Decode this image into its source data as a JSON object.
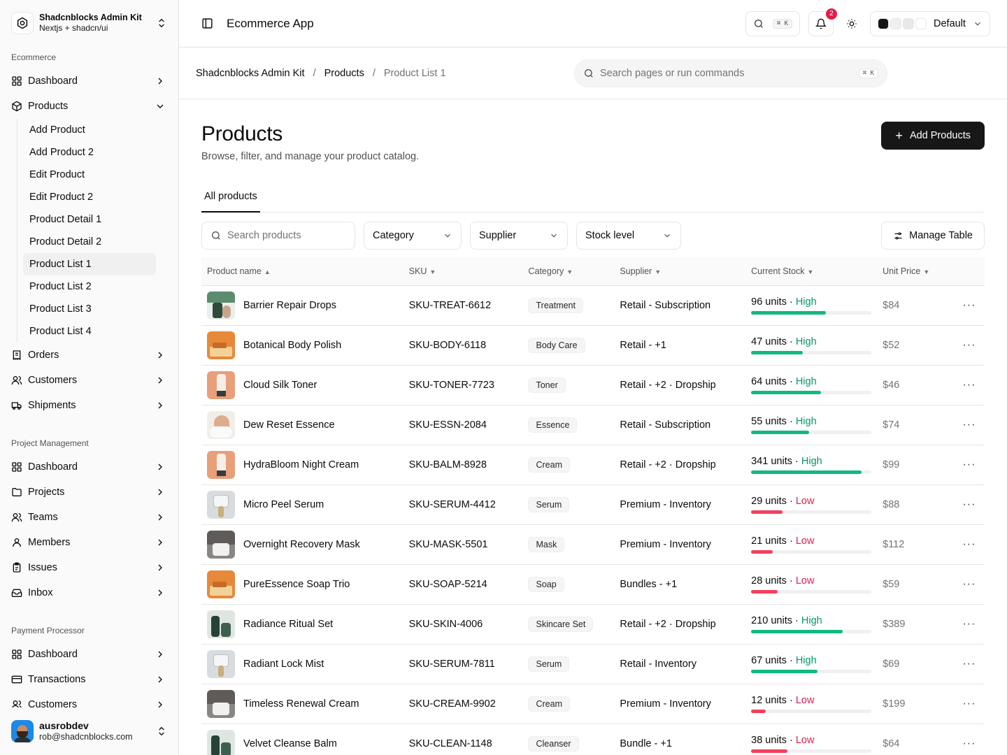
{
  "brand": {
    "title": "Shadcnblocks Admin Kit",
    "subtitle": "Nextjs + shadcn/ui"
  },
  "sidebar": {
    "ecommerce": {
      "label": "Ecommerce",
      "items": [
        {
          "label": "Dashboard",
          "icon": "layout-grid-icon"
        },
        {
          "label": "Products",
          "icon": "package-icon",
          "expanded": true,
          "children": [
            "Add Product",
            "Add Product 2",
            "Edit Product",
            "Edit Product 2",
            "Product Detail 1",
            "Product Detail 2",
            "Product List 1",
            "Product List 2",
            "Product List 3",
            "Product List 4"
          ],
          "active_child": "Product List 1"
        },
        {
          "label": "Orders",
          "icon": "receipt-icon"
        },
        {
          "label": "Customers",
          "icon": "users-icon"
        },
        {
          "label": "Shipments",
          "icon": "truck-icon"
        }
      ]
    },
    "project": {
      "label": "Project Management",
      "items": [
        {
          "label": "Dashboard",
          "icon": "layout-grid-icon"
        },
        {
          "label": "Projects",
          "icon": "folder-icon"
        },
        {
          "label": "Teams",
          "icon": "users-icon"
        },
        {
          "label": "Members",
          "icon": "user-icon"
        },
        {
          "label": "Issues",
          "icon": "clipboard-icon"
        },
        {
          "label": "Inbox",
          "icon": "inbox-icon"
        }
      ]
    },
    "payment": {
      "label": "Payment Processor",
      "items": [
        {
          "label": "Dashboard",
          "icon": "layout-grid-icon"
        },
        {
          "label": "Transactions",
          "icon": "credit-card-icon"
        },
        {
          "label": "Customers",
          "icon": "users-icon"
        }
      ]
    }
  },
  "user": {
    "name": "ausrobdev",
    "email": "rob@shadcnblocks.com"
  },
  "topbar": {
    "title": "Ecommerce App",
    "search_kbd": "⌘ K",
    "notif_count": "2",
    "theme_label": "Default",
    "swatches": [
      "#171717",
      "#f0f0f0",
      "#e8e8e8",
      "#ffffff"
    ]
  },
  "breadcrumb": {
    "items": [
      "Shadcnblocks Admin Kit",
      "Products",
      "Product List 1"
    ],
    "separator": "/"
  },
  "command": {
    "placeholder": "Search pages or run commands",
    "kbd": "⌘ K"
  },
  "page": {
    "title": "Products",
    "subtitle": "Browse, filter, and manage your product catalog.",
    "add_button": "Add Products"
  },
  "tabs": [
    "All products"
  ],
  "filters": {
    "search_placeholder": "Search products",
    "selects": [
      "Category",
      "Supplier",
      "Stock level"
    ],
    "manage": "Manage Table"
  },
  "table": {
    "columns": [
      "Product name",
      "SKU",
      "Category",
      "Supplier",
      "Current Stock",
      "Unit Price"
    ],
    "colors": {
      "high": "#10b981",
      "low": "#f43f5e"
    },
    "rows": [
      {
        "name": "Barrier Repair Drops",
        "sku": "SKU-TREAT-6612",
        "category": "Treatment",
        "supplier": "Retail - Subscription",
        "units": "96 units",
        "level": "High",
        "fill": 0.62,
        "price": "$84",
        "thumb": "green"
      },
      {
        "name": "Botanical Body Polish",
        "sku": "SKU-BODY-6118",
        "category": "Body Care",
        "supplier": "Retail - +1",
        "units": "47 units",
        "level": "High",
        "fill": 0.43,
        "price": "$52",
        "thumb": "orange"
      },
      {
        "name": "Cloud Silk Toner",
        "sku": "SKU-TONER-7723",
        "category": "Toner",
        "supplier": "Retail - +2 · Dropship",
        "units": "64 units",
        "level": "High",
        "fill": 0.58,
        "price": "$46",
        "thumb": "peach"
      },
      {
        "name": "Dew Reset Essence",
        "sku": "SKU-ESSN-2084",
        "category": "Essence",
        "supplier": "Retail - Subscription",
        "units": "55 units",
        "level": "High",
        "fill": 0.48,
        "price": "$74",
        "thumb": "skin"
      },
      {
        "name": "HydraBloom Night Cream",
        "sku": "SKU-BALM-8928",
        "category": "Cream",
        "supplier": "Retail - +2 · Dropship",
        "units": "341 units",
        "level": "High",
        "fill": 0.92,
        "price": "$99",
        "thumb": "peach"
      },
      {
        "name": "Micro Peel Serum",
        "sku": "SKU-SERUM-4412",
        "category": "Serum",
        "supplier": "Premium - Inventory",
        "units": "29 units",
        "level": "Low",
        "fill": 0.26,
        "price": "$88",
        "thumb": "glass"
      },
      {
        "name": "Overnight Recovery Mask",
        "sku": "SKU-MASK-5501",
        "category": "Mask",
        "supplier": "Premium - Inventory",
        "units": "21 units",
        "level": "Low",
        "fill": 0.18,
        "price": "$112",
        "thumb": "gray"
      },
      {
        "name": "PureEssence Soap Trio",
        "sku": "SKU-SOAP-5214",
        "category": "Soap",
        "supplier": "Bundles - +1",
        "units": "28 units",
        "level": "Low",
        "fill": 0.22,
        "price": "$59",
        "thumb": "orange"
      },
      {
        "name": "Radiance Ritual Set",
        "sku": "SKU-SKIN-4006",
        "category": "Skincare Set",
        "supplier": "Retail - +2 · Dropship",
        "units": "210 units",
        "level": "High",
        "fill": 0.76,
        "price": "$389",
        "thumb": "dark-green"
      },
      {
        "name": "Radiant Lock Mist",
        "sku": "SKU-SERUM-7811",
        "category": "Serum",
        "supplier": "Retail - Inventory",
        "units": "67 units",
        "level": "High",
        "fill": 0.55,
        "price": "$69",
        "thumb": "glass"
      },
      {
        "name": "Timeless Renewal Cream",
        "sku": "SKU-CREAM-9902",
        "category": "Cream",
        "supplier": "Premium - Inventory",
        "units": "12 units",
        "level": "Low",
        "fill": 0.12,
        "price": "$199",
        "thumb": "gray"
      },
      {
        "name": "Velvet Cleanse Balm",
        "sku": "SKU-CLEAN-1148",
        "category": "Cleanser",
        "supplier": "Bundle - +1",
        "units": "38 units",
        "level": "Low",
        "fill": 0.3,
        "price": "$64",
        "thumb": "dark-green"
      }
    ]
  }
}
